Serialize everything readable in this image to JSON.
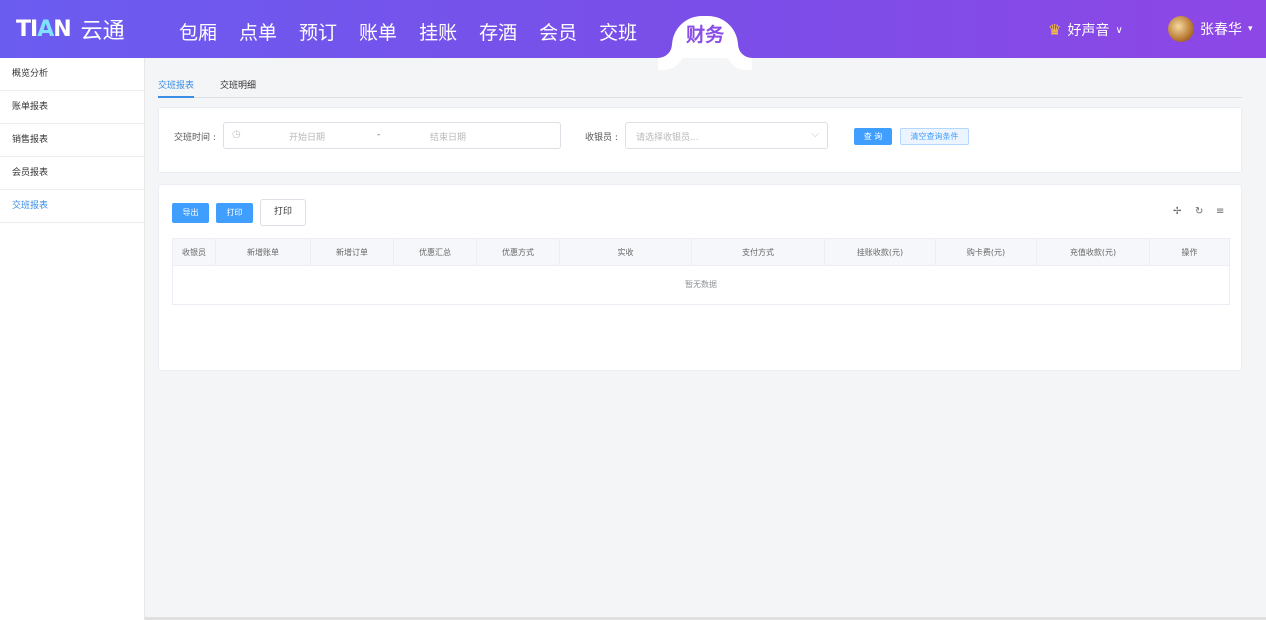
{
  "header": {
    "logo_mark_a": "TI",
    "logo_mark_b": "A",
    "logo_mark_c": "N",
    "logo_text": "云通",
    "nav": [
      {
        "label": "包厢"
      },
      {
        "label": "点单"
      },
      {
        "label": "预订"
      },
      {
        "label": "账单"
      },
      {
        "label": "挂账"
      },
      {
        "label": "存酒"
      },
      {
        "label": "会员"
      },
      {
        "label": "交班"
      },
      {
        "label": "财务",
        "active": true
      }
    ],
    "store_name": "好声音",
    "store_caret": "∨",
    "user_name": "张春华",
    "user_caret": "▾"
  },
  "sidebar": {
    "items": [
      {
        "label": "概览分析"
      },
      {
        "label": "账单报表"
      },
      {
        "label": "销售报表"
      },
      {
        "label": "会员报表"
      },
      {
        "label": "交班报表",
        "active": true
      }
    ]
  },
  "tabs": [
    {
      "label": "交班报表",
      "active": true
    },
    {
      "label": "交班明细"
    }
  ],
  "filter": {
    "time_label": "交班时间 :",
    "start_placeholder": "开始日期",
    "range_separator": "-",
    "end_placeholder": "结束日期",
    "cashier_label": "收银员 :",
    "cashier_placeholder": "请选择收银员...",
    "query_label": "查 询",
    "clear_label": "清空查询条件"
  },
  "toolbar": {
    "export_label": "导出",
    "print_label": "打印",
    "print2_label": "打印"
  },
  "table": {
    "columns": [
      "收银员",
      "新增账单",
      "新增订单",
      "优惠汇总",
      "优惠方式",
      "实收",
      "支付方式",
      "挂账收款(元)",
      "购卡费(元)",
      "充值收款(元)",
      "操作"
    ],
    "empty_text": "暂无数据"
  },
  "colors": {
    "accent": "#409eff",
    "header_gradient_start": "#6b5cf0",
    "header_gradient_end": "#8d47e6",
    "active_nav": "#8a4de7"
  }
}
